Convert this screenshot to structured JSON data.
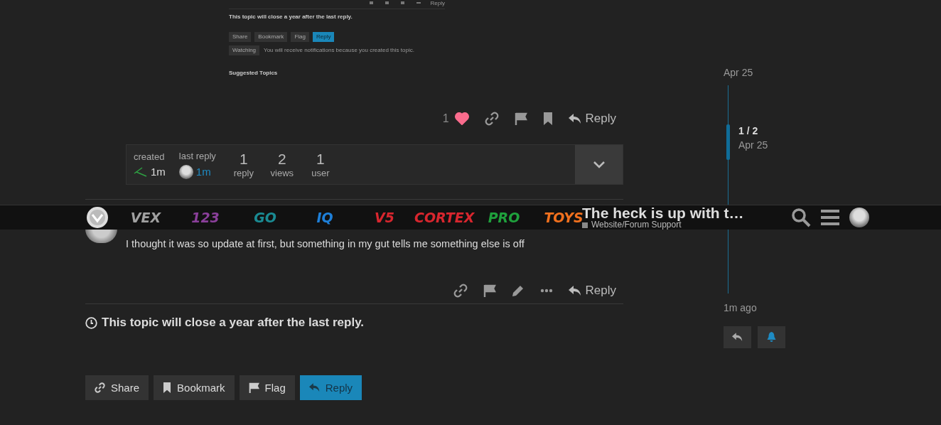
{
  "embedded_screenshot": {
    "action_reply": "Reply",
    "close_notice": "This topic will close a year after the last reply.",
    "buttons": [
      {
        "label": "Share",
        "kind": "plain"
      },
      {
        "label": "Bookmark",
        "kind": "plain"
      },
      {
        "label": "Flag",
        "kind": "plain"
      },
      {
        "label": "Reply",
        "kind": "primary"
      }
    ],
    "notification": {
      "label": "Watching",
      "text": "You will receive notifications because you created this topic."
    },
    "suggested_title": "Suggested Topics"
  },
  "first_post": {
    "like_count": "1",
    "liked": true,
    "reply_label": "Reply"
  },
  "topic_map": {
    "created_label": "created",
    "created_time": "1m",
    "last_reply_label": "last reply",
    "last_reply_time": "1m",
    "stats": [
      {
        "value": "1",
        "label": "reply"
      },
      {
        "value": "2",
        "label": "views"
      },
      {
        "value": "1",
        "label": "user"
      }
    ],
    "expanded": false
  },
  "header": {
    "logos": [
      {
        "text": "VEX",
        "color": "#a0a0a0"
      },
      {
        "text": "123",
        "color": "#8a3f9a"
      },
      {
        "text": "GO",
        "color": "#1a8a92"
      },
      {
        "text": "IQ",
        "color": "#1e7fd8"
      },
      {
        "text": "V5",
        "color": "#d8262e"
      },
      {
        "text": "CORTEX",
        "color": "#d8262e"
      },
      {
        "text": "PRO",
        "color": "#1fa03c"
      },
      {
        "text": "TOYS",
        "color": "#f0701e"
      }
    ],
    "title": "The heck is up with t…",
    "category": "Website/Forum Support"
  },
  "second_post": {
    "text": "I thought it was so update at first, but something in my gut tells me something else is off",
    "reply_label": "Reply"
  },
  "close_notice": "This topic will close a year after the last reply.",
  "footer_buttons": [
    {
      "label": "Share",
      "kind": "share"
    },
    {
      "label": "Bookmark",
      "kind": "bookmark"
    },
    {
      "label": "Flag",
      "kind": "flag"
    },
    {
      "label": "Reply",
      "kind": "reply"
    }
  ],
  "timeline": {
    "start_date": "Apr 25",
    "position": "1 / 2",
    "position_date": "Apr 25",
    "end_label": "1m ago"
  }
}
